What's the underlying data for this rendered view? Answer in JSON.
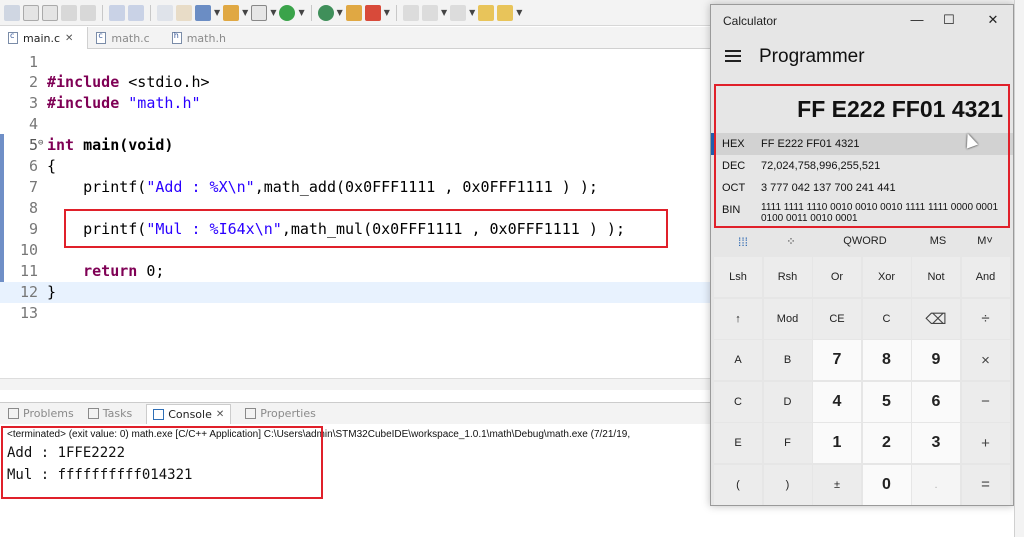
{
  "editor_tabs": [
    {
      "label": "main.c",
      "active": true
    },
    {
      "label": "math.c",
      "active": false
    },
    {
      "label": "math.h",
      "active": false
    }
  ],
  "code_lines": [
    {
      "n": "1",
      "text": ""
    },
    {
      "n": "2",
      "pre": "#include",
      "rest": " <stdio.h>"
    },
    {
      "n": "3",
      "pre": "#include",
      "str": " \"math.h\""
    },
    {
      "n": "4",
      "text": ""
    },
    {
      "n": "5",
      "kw": "int",
      "rest": " main(void)"
    },
    {
      "n": "6",
      "text": "{"
    },
    {
      "n": "7",
      "p1": "    printf(",
      "s1": "\"Add : %X\\n\"",
      "p2": ",math_add(0x0FFF1111 , 0x0FFF1111 ) );"
    },
    {
      "n": "8",
      "text": ""
    },
    {
      "n": "9",
      "p1": "    printf(",
      "s1": "\"Mul : %I64x\\n\"",
      "p2": ",math_mul(0x0FFF1111 , 0x0FFF1111 ) );"
    },
    {
      "n": "10",
      "text": ""
    },
    {
      "n": "11",
      "kw2": "return",
      "rest2": " 0;"
    },
    {
      "n": "12",
      "text": "}"
    },
    {
      "n": "13",
      "text": ""
    }
  ],
  "view_tabs": {
    "problems": "Problems",
    "tasks": "Tasks",
    "console": "Console",
    "properties": "Properties"
  },
  "console": {
    "status": "<terminated> (exit value: 0) math.exe [C/C++ Application] C:\\Users\\admin\\STM32CubeIDE\\workspace_1.0.1\\math\\Debug\\math.exe (7/21/19,",
    "line1": "Add : 1FFE2222",
    "line2": "Mul : ffffffffff014321"
  },
  "calculator": {
    "window_title": "Calculator",
    "mode": "Programmer",
    "display": "FF E222 FF01 4321",
    "hex_label": "HEX",
    "hex_value": "FF E222 FF01 4321",
    "dec_label": "DEC",
    "dec_value": "72,024,758,996,255,521",
    "oct_label": "OCT",
    "oct_value": "3 777 042 137 700 241 441",
    "bin_label": "BIN",
    "bin_value": "1111 1111 1110 0010 0010 0010 1111 1111 0000 0001 0100 0011 0010 0001",
    "qword": "QWORD",
    "ms": "MS",
    "mplus": "M˅",
    "keys": [
      [
        "Lsh",
        "Rsh",
        "Or",
        "Xor",
        "Not",
        "And"
      ],
      [
        "↑",
        "Mod",
        "CE",
        "C",
        "⌫",
        "÷"
      ],
      [
        "A",
        "B",
        "7",
        "8",
        "9",
        "×"
      ],
      [
        "C",
        "D",
        "4",
        "5",
        "6",
        "−"
      ],
      [
        "E",
        "F",
        "1",
        "2",
        "3",
        "+"
      ],
      [
        "(",
        ")",
        "±",
        "0",
        ".",
        "="
      ]
    ]
  },
  "colors": {
    "highlight": "#e0202a",
    "keyword": "#7f0055",
    "string": "#2a00ff"
  }
}
